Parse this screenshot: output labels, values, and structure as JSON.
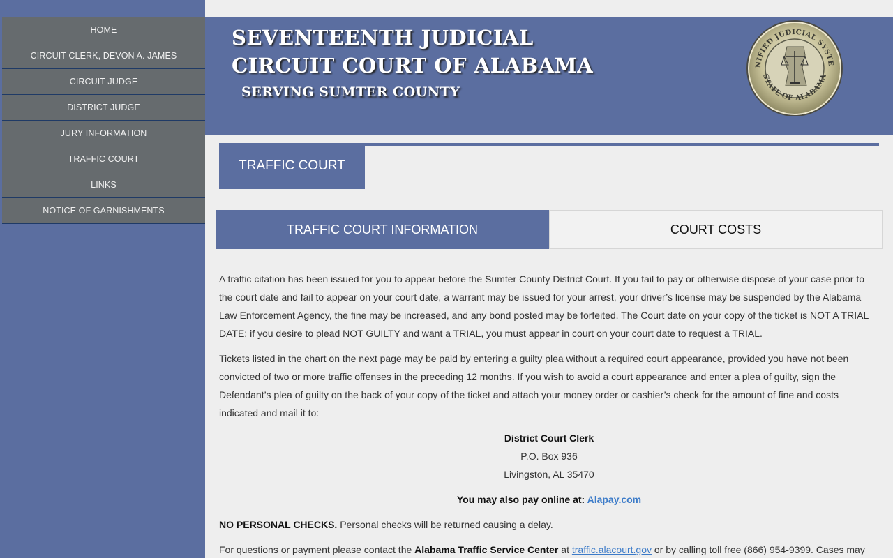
{
  "nav": {
    "items": [
      {
        "label": "HOME"
      },
      {
        "label": "CIRCUIT CLERK, DEVON A. JAMES"
      },
      {
        "label": "CIRCUIT JUDGE"
      },
      {
        "label": "DISTRICT JUDGE"
      },
      {
        "label": "JURY INFORMATION"
      },
      {
        "label": "TRAFFIC COURT"
      },
      {
        "label": "LINKS"
      },
      {
        "label": "NOTICE OF GARNISHMENTS"
      }
    ]
  },
  "banner": {
    "line1": "SEVENTEENTH  JUDICIAL",
    "line2": "CIRCUIT COURT OF ALABAMA",
    "line3": "SERVING SUMTER COUNTY",
    "seal": {
      "top_text": "UNIFIED JUDICIAL SYSTEM",
      "bottom_text": "STATE OF ALABAMA",
      "colors": {
        "ring": "#8a8f90",
        "inner": "#b8b48a",
        "blue": "#5b6ea0"
      }
    }
  },
  "section": {
    "title": "TRAFFIC COURT"
  },
  "tabs": [
    {
      "label": "TRAFFIC COURT INFORMATION",
      "active": true
    },
    {
      "label": "COURT COSTS",
      "active": false
    }
  ],
  "content": {
    "para1": "A traffic citation has been issued for you to appear before the Sumter County District Court. If you fail to pay or otherwise dispose of your case prior to the court date and fail to appear on your court date, a warrant may be issued for your arrest, your driver’s license may be suspended by the Alabama Law Enforcement Agency, the fine may be increased, and any bond posted may be forfeited. The Court date on your copy of the ticket is NOT A TRIAL DATE; if you desire to plead NOT GUILTY and want a TRIAL, you must appear in court on your court date to request a TRIAL.",
    "para2": "Tickets listed in the chart on the next page may be paid by entering a guilty plea without a required court appearance, provided you have not been convicted of two or more traffic offenses in the preceding 12 months. If you wish to avoid a court appearance and enter a plea of guilty, sign the Defendant’s plea of guilty on the back of your copy of the ticket and attach your money order or cashier’s check for the amount of fine and costs indicated and mail it to:",
    "address": {
      "name": "District Court Clerk",
      "line1": "P.O. Box 936",
      "line2": "Livingston, AL 35470"
    },
    "online": {
      "prefix": "You may also pay online at: ",
      "link": "Alapay.com"
    },
    "checks": {
      "bold": "NO PERSONAL CHECKS.",
      "text": " Personal checks will be returned causing a delay."
    },
    "contact": {
      "prefix": "For questions or payment please contact the ",
      "bold": "Alabama Traffic Service Center",
      "mid": " at ",
      "link": "traffic.alacourt.gov",
      "suffix": " or by calling toll free (866) 954-9399. Cases may"
    }
  }
}
